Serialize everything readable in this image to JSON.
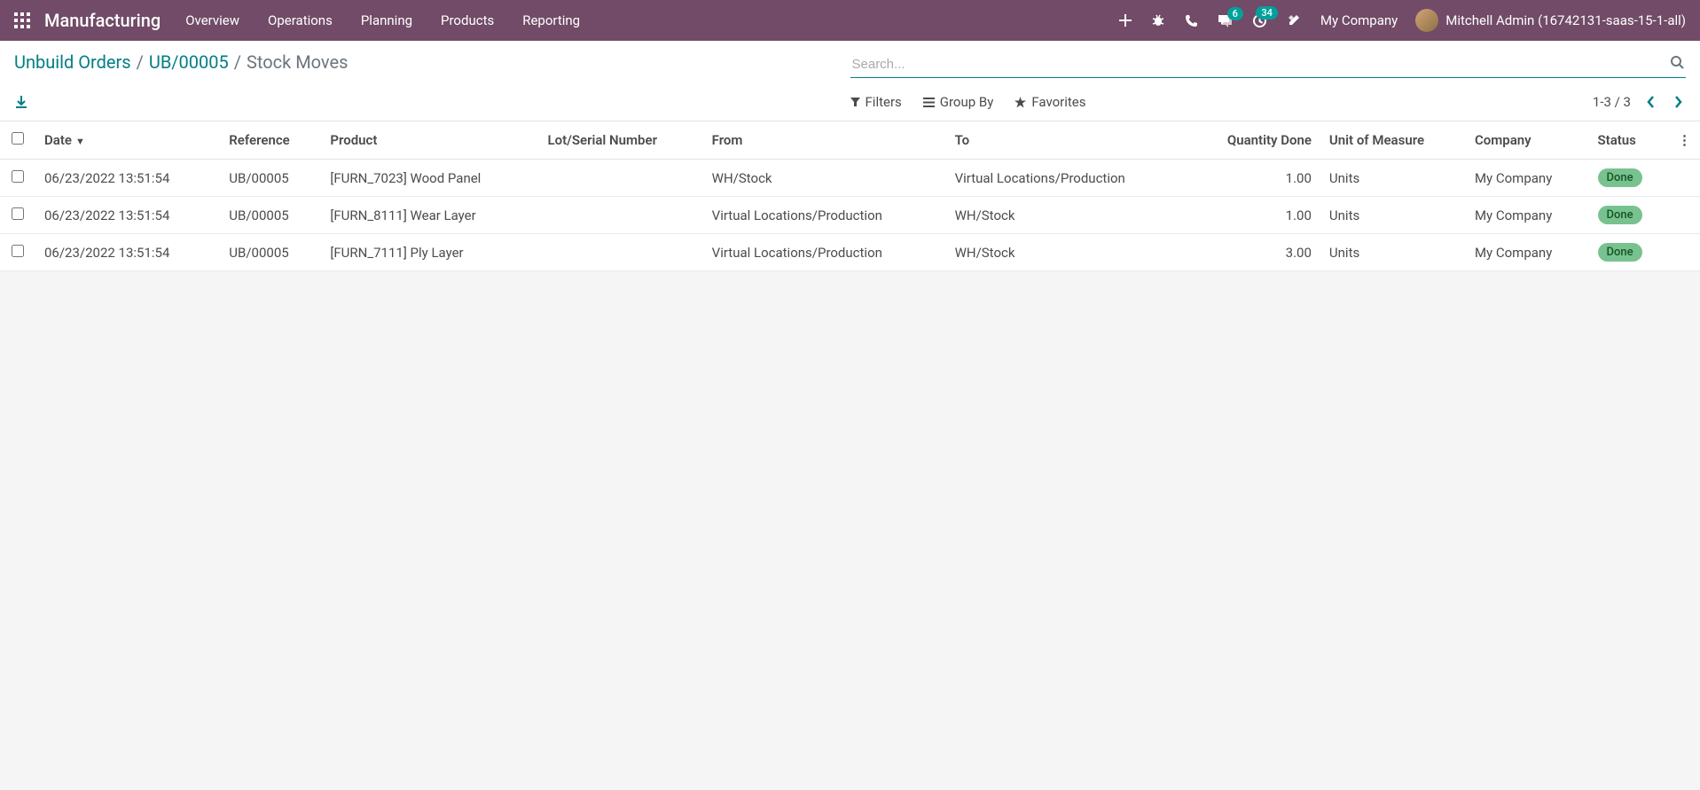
{
  "navbar": {
    "app_title": "Manufacturing",
    "menu": [
      "Overview",
      "Operations",
      "Planning",
      "Products",
      "Reporting"
    ],
    "badge_messages": "6",
    "badge_activities": "34",
    "company": "My Company",
    "user": "Mitchell Admin (16742131-saas-15-1-all)"
  },
  "breadcrumb": {
    "root": "Unbuild Orders",
    "parent": "UB/00005",
    "current": "Stock Moves"
  },
  "search": {
    "placeholder": "Search..."
  },
  "filters": {
    "filters_label": "Filters",
    "groupby_label": "Group By",
    "favorites_label": "Favorites"
  },
  "pager": {
    "text": "1-3 / 3"
  },
  "table": {
    "headers": {
      "date": "Date",
      "reference": "Reference",
      "product": "Product",
      "lot": "Lot/Serial Number",
      "from": "From",
      "to": "To",
      "qty": "Quantity Done",
      "uom": "Unit of Measure",
      "company": "Company",
      "status": "Status"
    },
    "rows": [
      {
        "date": "06/23/2022 13:51:54",
        "reference": "UB/00005",
        "product": "[FURN_7023] Wood Panel",
        "lot": "",
        "from": "WH/Stock",
        "to": "Virtual Locations/Production",
        "qty": "1.00",
        "uom": "Units",
        "company": "My Company",
        "status": "Done"
      },
      {
        "date": "06/23/2022 13:51:54",
        "reference": "UB/00005",
        "product": "[FURN_8111] Wear Layer",
        "lot": "",
        "from": "Virtual Locations/Production",
        "to": "WH/Stock",
        "qty": "1.00",
        "uom": "Units",
        "company": "My Company",
        "status": "Done"
      },
      {
        "date": "06/23/2022 13:51:54",
        "reference": "UB/00005",
        "product": "[FURN_7111] Ply Layer",
        "lot": "",
        "from": "Virtual Locations/Production",
        "to": "WH/Stock",
        "qty": "3.00",
        "uom": "Units",
        "company": "My Company",
        "status": "Done"
      }
    ]
  }
}
